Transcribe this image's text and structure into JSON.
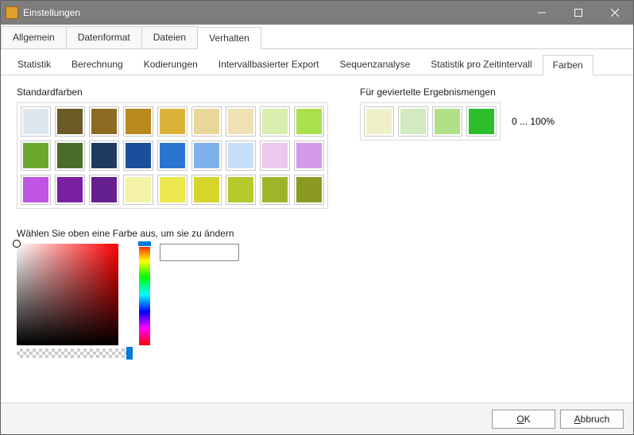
{
  "window": {
    "title": "Einstellungen"
  },
  "mainTabs": {
    "items": [
      "Allgemein",
      "Datenformat",
      "Dateien",
      "Verhalten"
    ],
    "active": 3
  },
  "subTabs": {
    "items": [
      "Statistik",
      "Berechnung",
      "Kodierungen",
      "Intervallbasierter Export",
      "Sequenzanalyse",
      "Statistik pro Zeitintervall",
      "Farben"
    ],
    "active": 6
  },
  "labels": {
    "standard": "Standardfarben",
    "quartile": "Für geviertelte Ergebnismengen",
    "range": "0 ... 100%",
    "pickerHint": "Wählen Sie oben eine Farbe aus, um sie zu ändern"
  },
  "standardColors": [
    "#dde6ef",
    "#6b5a25",
    "#8c6a1f",
    "#b88a1c",
    "#dab23b",
    "#e8d69a",
    "#efe1b3",
    "#d7eeae",
    "#a9e04b",
    "#6aa82b",
    "#4a6e2a",
    "#1f3a5f",
    "#1c4f9b",
    "#2a74d0",
    "#7fb1ec",
    "#c9def7",
    "#ecc8ef",
    "#d49ae9",
    "#c054e3",
    "#7b1fa2",
    "#651f8f",
    "#f4f2a8",
    "#ebe94d",
    "#d5d52b",
    "#b7c92a",
    "#9db52a",
    "#8a9a20"
  ],
  "quartileColors": [
    "#eff0c8",
    "#d2eac0",
    "#b0e088",
    "#2bbf2b"
  ],
  "buttons": {
    "ok": "OK",
    "cancel": "Abbruch"
  },
  "chart_data": {
    "type": "table",
    "title": "Color palettes",
    "standard_palette": [
      "#dde6ef",
      "#6b5a25",
      "#8c6a1f",
      "#b88a1c",
      "#dab23b",
      "#e8d69a",
      "#efe1b3",
      "#d7eeae",
      "#a9e04b",
      "#6aa82b",
      "#4a6e2a",
      "#1f3a5f",
      "#1c4f9b",
      "#2a74d0",
      "#7fb1ec",
      "#c9def7",
      "#ecc8ef",
      "#d49ae9",
      "#c054e3",
      "#7b1fa2",
      "#651f8f",
      "#f4f2a8",
      "#ebe94d",
      "#d5d52b",
      "#b7c92a",
      "#9db52a",
      "#8a9a20"
    ],
    "quartile_palette": [
      "#eff0c8",
      "#d2eac0",
      "#b0e088",
      "#2bbf2b"
    ],
    "quartile_range": "0 ... 100%"
  }
}
